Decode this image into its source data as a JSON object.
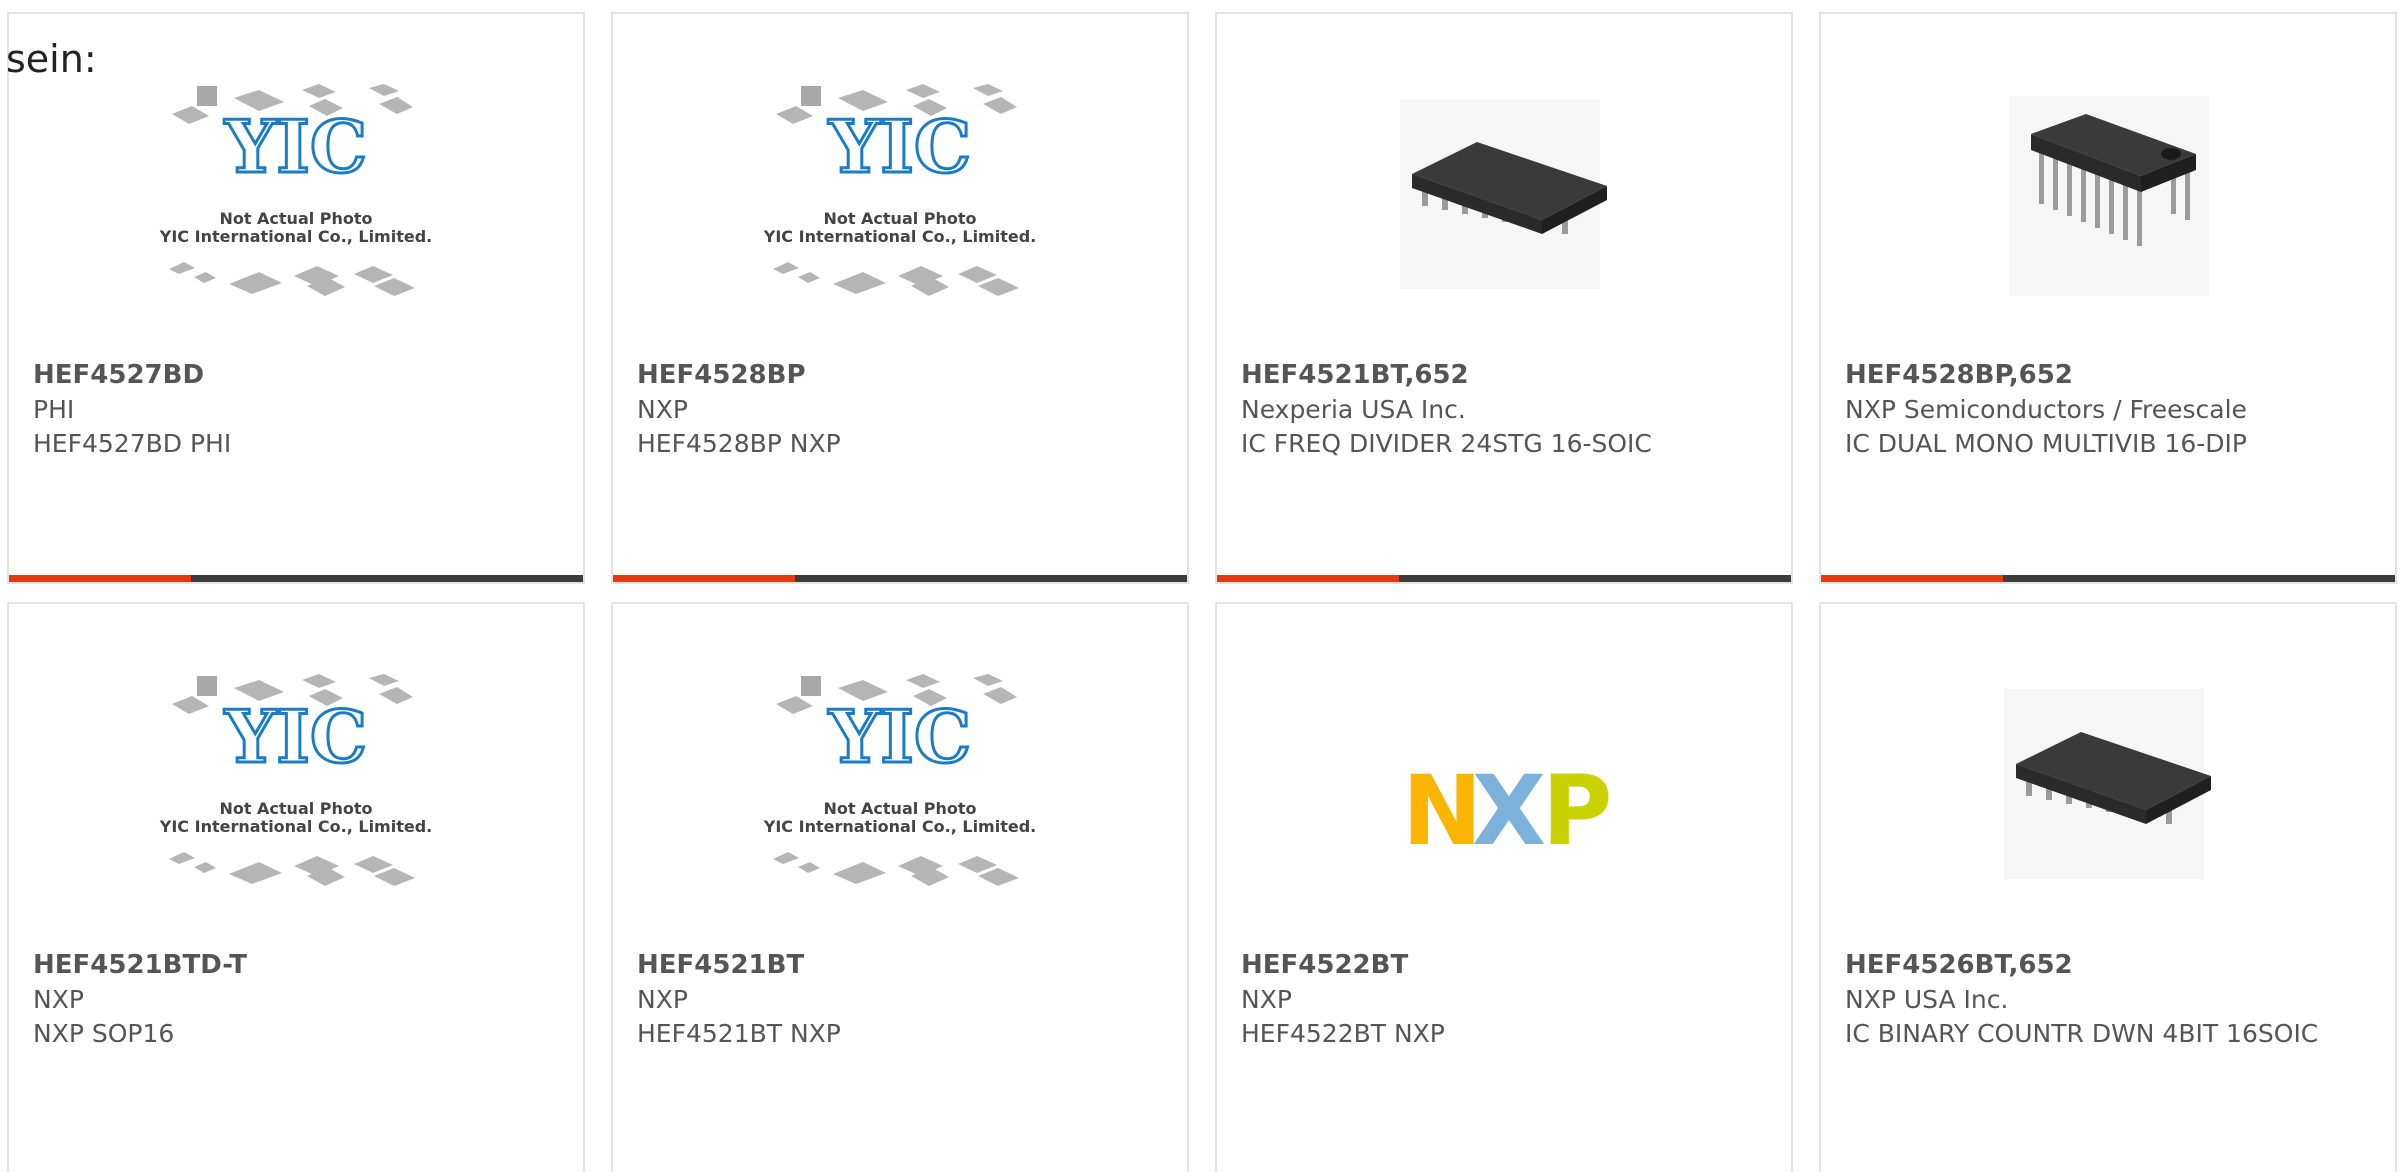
{
  "heading": {
    "text": "sein:"
  },
  "placeholder": {
    "line1": "Not Actual Photo",
    "line2": "YIC International Co., Limited.",
    "logo": "YIC"
  },
  "nxp_logo": {
    "letters": [
      "N",
      "X",
      "P"
    ]
  },
  "colors": {
    "accent_bar": "#e53a10",
    "bar_base": "#3b3b3b",
    "border": "#e3e3e3",
    "yic_blue": "#1a7bc7"
  },
  "products": [
    {
      "part": "HEF4527BD",
      "maker": "PHI",
      "desc": "HEF4527BD PHI",
      "image": "yic-placeholder"
    },
    {
      "part": "HEF4528BP",
      "maker": "NXP",
      "desc": "HEF4528BP NXP",
      "image": "yic-placeholder"
    },
    {
      "part": "HEF4521BT,652",
      "maker": "Nexperia USA Inc.",
      "desc": "IC FREQ DIVIDER 24STG 16-SOIC",
      "image": "soic-chip"
    },
    {
      "part": "HEF4528BP,652",
      "maker": "NXP Semiconductors / Freescale",
      "desc": "IC DUAL MONO MULTIVIB 16-DIP",
      "image": "dip-chip"
    },
    {
      "part": "HEF4521BTD-T",
      "maker": "NXP",
      "desc": "NXP SOP16",
      "image": "yic-placeholder"
    },
    {
      "part": "HEF4521BT",
      "maker": "NXP",
      "desc": "HEF4521BT NXP",
      "image": "yic-placeholder"
    },
    {
      "part": "HEF4522BT",
      "maker": "NXP",
      "desc": "HEF4522BT NXP",
      "image": "nxp-logo"
    },
    {
      "part": "HEF4526BT,652",
      "maker": "NXP USA Inc.",
      "desc": "IC BINARY COUNTR DWN 4BIT 16SOIC",
      "image": "soic-chip"
    }
  ]
}
